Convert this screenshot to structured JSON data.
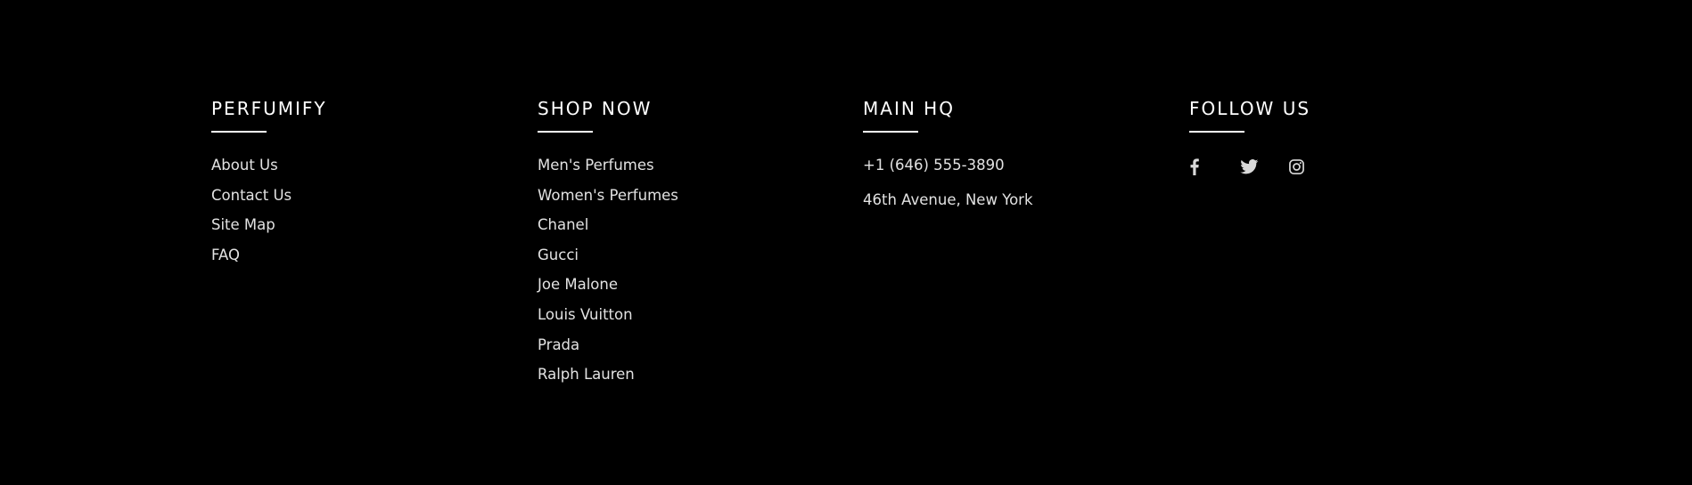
{
  "columns": [
    {
      "heading": "PERFUMIFY",
      "links": [
        "About Us",
        "Contact Us",
        "Site Map",
        "FAQ"
      ]
    },
    {
      "heading": "SHOP NOW",
      "links": [
        "Men's Perfumes",
        "Women's Perfumes",
        "Chanel",
        "Gucci",
        "Joe Malone",
        "Louis Vuitton",
        "Prada",
        "Ralph Lauren"
      ]
    },
    {
      "heading": "MAIN HQ",
      "phone": "+1 (646) 555-3890",
      "address": "46th Avenue, New York"
    },
    {
      "heading": "FOLLOW US",
      "icons": [
        "facebook-icon",
        "twitter-icon",
        "instagram-icon"
      ]
    }
  ],
  "colors": {
    "background": "#000000",
    "heading": "#ffffff",
    "link": "#e2e2e2",
    "icon": "#d9d9d9"
  }
}
